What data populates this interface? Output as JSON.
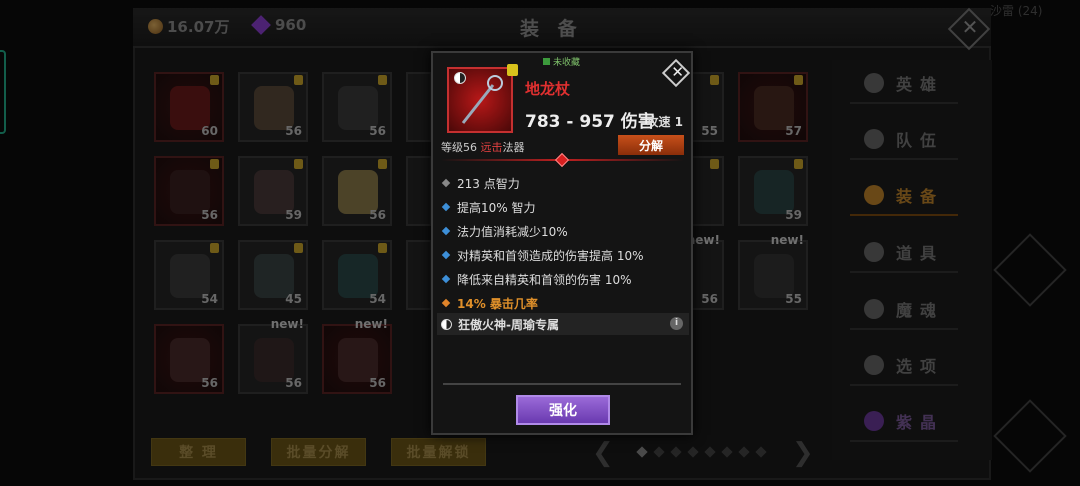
{
  "header": {
    "gold": "16.07万",
    "gems": "960",
    "title": "装 备",
    "corner_text": "沙雷 (24)"
  },
  "grid": {
    "slots": [
      {
        "level": "60",
        "new": ""
      },
      {
        "level": "56",
        "new": ""
      },
      {
        "level": "56",
        "new": ""
      },
      {
        "level": "",
        "new": ""
      },
      {
        "level": "56",
        "new": ""
      },
      {
        "level": "59",
        "new": ""
      },
      {
        "level": "56",
        "new": ""
      },
      {
        "level": "",
        "new": ""
      },
      {
        "level": "54",
        "new": ""
      },
      {
        "level": "45",
        "new": ""
      },
      {
        "level": "54",
        "new": ""
      },
      {
        "level": "",
        "new": ""
      },
      {
        "level": "56",
        "new": ""
      },
      {
        "level": "56",
        "new": "new!"
      },
      {
        "level": "56",
        "new": "new!"
      },
      {
        "level": "",
        "new": ""
      },
      {
        "level": "55",
        "new": ""
      },
      {
        "level": "57",
        "new": ""
      },
      {
        "level": "",
        "new": ""
      },
      {
        "level": "59",
        "new": ""
      },
      {
        "level": "56",
        "new": "new!"
      },
      {
        "level": "55",
        "new": "new!"
      }
    ]
  },
  "nav": {
    "items": [
      {
        "label": "英雄",
        "icon": "hero-icon",
        "active": false
      },
      {
        "label": "队伍",
        "icon": "flag-icon",
        "active": false
      },
      {
        "label": "装备",
        "icon": "helmet-icon",
        "active": true
      },
      {
        "label": "道具",
        "icon": "bag-icon",
        "active": false
      },
      {
        "label": "魔魂",
        "icon": "flame-icon",
        "active": false
      },
      {
        "label": "选项",
        "icon": "gear-icon",
        "active": false
      },
      {
        "label": "紫晶",
        "icon": "crystal-icon",
        "active": false
      }
    ]
  },
  "bottom": {
    "sort": "整 理",
    "batch_split": "批量分解",
    "batch_unlock": "批量解锁"
  },
  "popup": {
    "favorite": "未收藏",
    "name": "地龙杖",
    "damage": "783 - 957 伤害",
    "speed": "攻速 1",
    "level_prefix": "等级56 ",
    "range": "远击",
    "type": "法器",
    "split": "分解",
    "stats": [
      {
        "text": "213 点智力",
        "kind": "grey"
      },
      {
        "text": "提高10% 智力",
        "kind": "blue"
      },
      {
        "text": "法力值消耗减少10%",
        "kind": "blue"
      },
      {
        "text": "对精英和首领造成的伤害提高 10%",
        "kind": "blue"
      },
      {
        "text": "降低来自精英和首领的伤害 10%",
        "kind": "blue"
      },
      {
        "text": "14% 暴击几率",
        "kind": "orange"
      }
    ],
    "set_text": "狂傲火神-周瑜专属",
    "strengthen": "强化"
  },
  "colors": {
    "accent_orange": "#c0842a",
    "item_red": "#e03030",
    "strengthen_purple": "#7a4ac0"
  }
}
